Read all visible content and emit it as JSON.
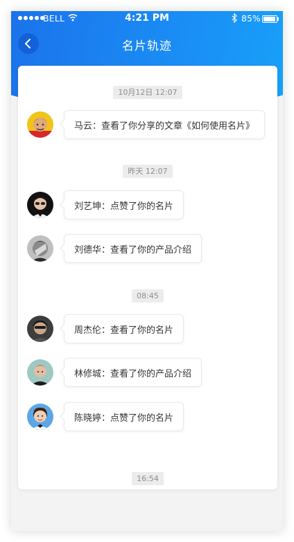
{
  "status_bar": {
    "carrier": "BELL",
    "time": "4:21 PM",
    "battery": "85%",
    "battery_level": 0.85
  },
  "nav": {
    "title": "名片轨迹"
  },
  "timeline": [
    {
      "time": "10月12日  12:07",
      "events": [
        {
          "text": "马云：查看了你分享的文章《如何使用名片》",
          "avatar": "avatar-1"
        }
      ]
    },
    {
      "time": "昨天  12:07",
      "events": [
        {
          "text": "刘艺坤：点赞了你的名片",
          "avatar": "avatar-2"
        },
        {
          "text": "刘德华：查看了你的产品介绍",
          "avatar": "avatar-3"
        }
      ]
    },
    {
      "time": "08:45",
      "events": [
        {
          "text": "周杰伦：查看了你的名片",
          "avatar": "avatar-4"
        },
        {
          "text": "林修城：查看了你的产品介绍",
          "avatar": "avatar-5"
        },
        {
          "text": "陈晓婷：点赞了你的名片",
          "avatar": "avatar-6"
        }
      ]
    },
    {
      "time": "16:54",
      "events": []
    }
  ],
  "colors": {
    "header_start": "#1c69e8",
    "header_end": "#16a8fb",
    "card": "#ffffff",
    "background": "#f3f3f3"
  }
}
